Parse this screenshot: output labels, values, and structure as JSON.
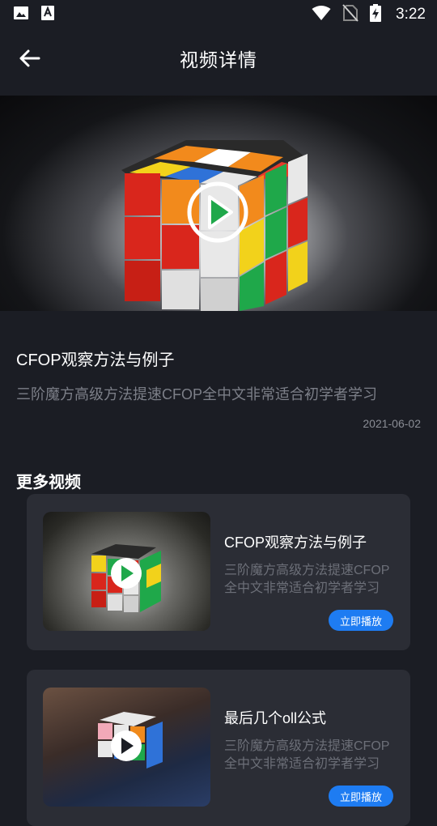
{
  "status_bar": {
    "time": "3:22",
    "icons": [
      "image-icon",
      "text-a-icon",
      "wifi-icon",
      "no-sim-icon",
      "battery-charging-icon"
    ]
  },
  "header": {
    "title": "视频详情",
    "back_icon": "arrow-left-icon"
  },
  "video": {
    "title": "CFOP观察方法与例子",
    "description": "三阶魔方高级方法提速CFOP全中文非常适合初学者学习",
    "date": "2021-06-02",
    "play_icon": "play-circle-icon"
  },
  "more": {
    "section_title": "更多视频",
    "items": [
      {
        "title": "CFOP观察方法与例子",
        "description": "三阶魔方高级方法提速CFOP全中文非常适合初学者学习",
        "button_label": "立即播放"
      },
      {
        "title": "最后几个oll公式",
        "description": "三阶魔方高级方法提速CFOP全中文非常适合初学者学习",
        "button_label": "立即播放"
      }
    ]
  },
  "colors": {
    "background": "#1b1d24",
    "card": "#2b2d35",
    "accent": "#1e7cf2",
    "play_green": "#1fa84a",
    "muted_text": "#7c7f88"
  }
}
